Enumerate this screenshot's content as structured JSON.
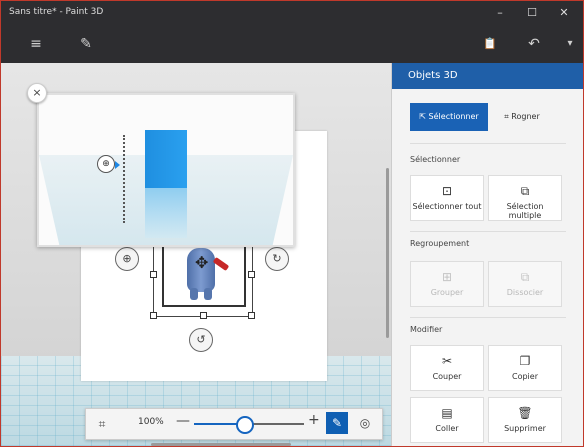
{
  "window": {
    "title": "Sans titre* - Paint 3D",
    "controls": [
      "–",
      "☐",
      "✕"
    ]
  },
  "toolbar": {
    "menu_icon": "≡",
    "brush_icon": "✎",
    "paste_icon": "📋",
    "undo_icon": "↶",
    "more_icon": "▾"
  },
  "canvas": {
    "close_label": "×"
  },
  "zoom": {
    "value": "100%",
    "minus": "—",
    "plus": "+",
    "level_fraction": 0.45
  },
  "panel": {
    "header": "Objets 3D",
    "modes": {
      "select": "Sélectionner",
      "crop": "Rogner"
    },
    "sections": {
      "select": "Sélectionner",
      "group": "Regroupement",
      "modify": "Modifier"
    },
    "buttons": {
      "select_all": "Sélectionner tout",
      "multi_select": "Sélection multiple",
      "group": "Grouper",
      "ungroup": "Dissocier",
      "cut": "Couper",
      "copy": "Copier",
      "paste": "Coller",
      "delete": "Supprimer"
    }
  },
  "colors": {
    "accent": "#1a62b5",
    "panel_header": "#1f5fa8",
    "cube": "#1f8fe0"
  }
}
